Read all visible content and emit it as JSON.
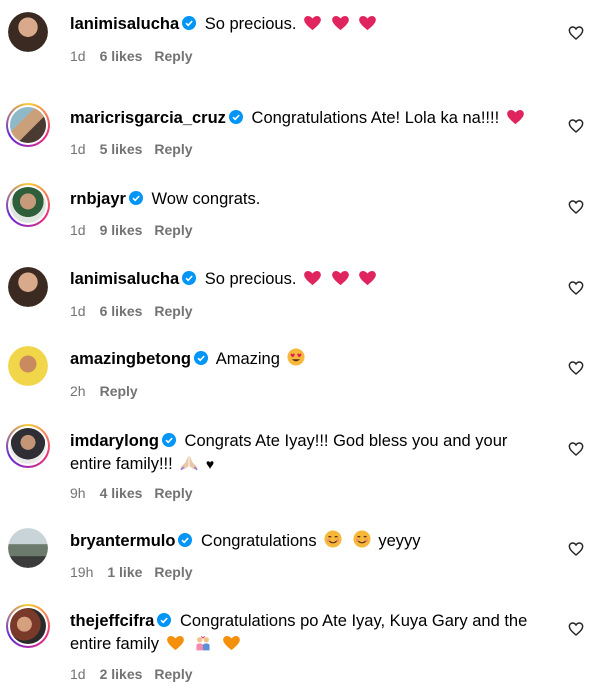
{
  "comments": [
    {
      "username": "lanimisalucha",
      "text": "So precious.",
      "emojis": "red-heart x3",
      "time": "1d",
      "likes": "6 likes",
      "reply": "Reply"
    },
    {
      "username": "maricrisgarcia_cruz",
      "text": "Congratulations Ate! Lola ka na!!!!",
      "emojis": "red-heart",
      "time": "1d",
      "likes": "5 likes",
      "reply": "Reply"
    },
    {
      "username": "rnbjayr",
      "text": "Wow congrats.",
      "time": "1d",
      "likes": "9 likes",
      "reply": "Reply"
    },
    {
      "username": "lanimisalucha",
      "text": "So precious.",
      "emojis": "red-heart x3",
      "time": "1d",
      "likes": "6 likes",
      "reply": "Reply"
    },
    {
      "username": "amazingbetong",
      "text": "Amazing",
      "emojis": "heart-eyes",
      "time": "2h",
      "likes": "",
      "reply": "Reply"
    },
    {
      "username": "imdarylong",
      "text": "Congrats Ate Iyay!!! God bless you and your entire family!!!",
      "emojis": "praying-hands, black-heart",
      "black_heart": "♥",
      "time": "9h",
      "likes": "4 likes",
      "reply": "Reply"
    },
    {
      "username": "bryantermulo",
      "text": "Congratulations",
      "text_after": "yeyyy",
      "emojis": "smiling-face x2",
      "time": "19h",
      "likes": "1 like",
      "reply": "Reply"
    },
    {
      "username": "thejeffcifra",
      "text": "Congratulations po Ate Iyay, Kuya Gary and the entire family",
      "emojis": "orange-heart, couple, orange-heart",
      "time": "1d",
      "likes": "2 likes",
      "reply": "Reply"
    }
  ],
  "colors": {
    "verified": "#0095f6",
    "meta": "#737373",
    "red_heart": "#e0245e",
    "orange_heart": "#f4900c"
  },
  "icons": {
    "like": "heart-outline-icon",
    "verified": "verified-badge-icon"
  }
}
